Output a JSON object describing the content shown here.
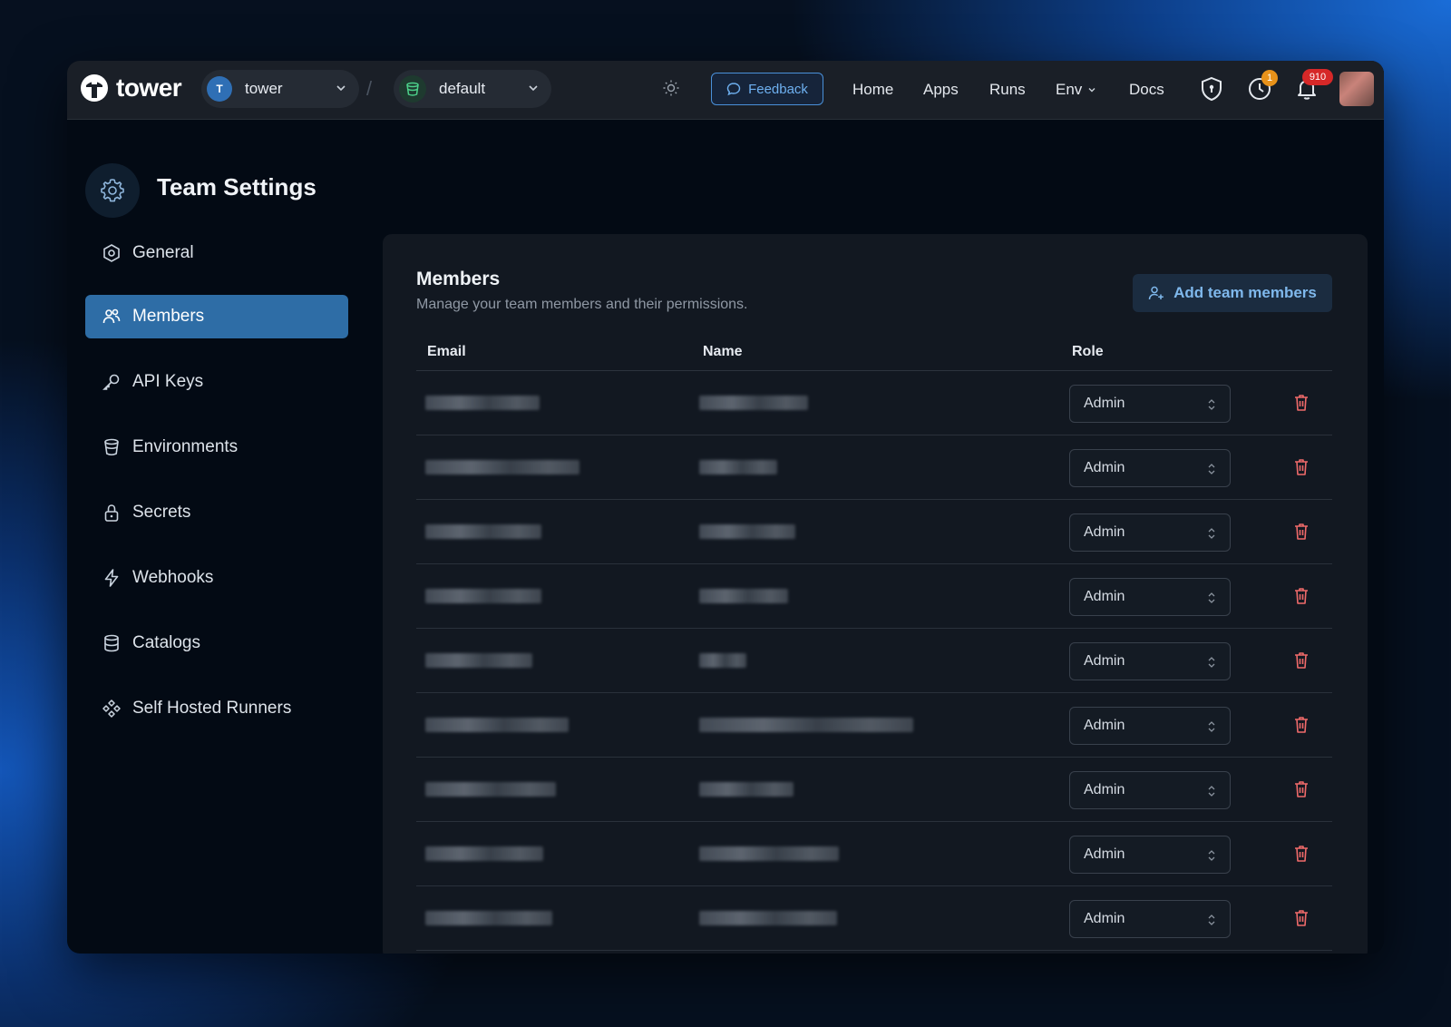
{
  "app": {
    "logo_text": "tower",
    "team_selector": {
      "initial": "T",
      "label": "tower"
    },
    "env_selector": {
      "label": "default"
    },
    "feedback_label": "Feedback",
    "nav": [
      "Home",
      "Apps",
      "Runs",
      "Env",
      "Docs"
    ],
    "runs_badge": "1",
    "notifications_badge": "910",
    "accent": "#2e6da6"
  },
  "sidebar": {
    "title": "Team Settings",
    "items": [
      {
        "label": "General",
        "icon": "hexagon-settings-icon"
      },
      {
        "label": "Members",
        "icon": "users-icon",
        "active": true
      },
      {
        "label": "API Keys",
        "icon": "key-icon"
      },
      {
        "label": "Environments",
        "icon": "bucket-icon"
      },
      {
        "label": "Secrets",
        "icon": "lock-icon"
      },
      {
        "label": "Webhooks",
        "icon": "bolt-icon"
      },
      {
        "label": "Catalogs",
        "icon": "database-icon"
      },
      {
        "label": "Self Hosted Runners",
        "icon": "runners-icon"
      }
    ]
  },
  "members": {
    "title": "Members",
    "subtitle": "Manage your team members and their permissions.",
    "add_button": "Add team members",
    "columns": {
      "email": "Email",
      "name": "Name",
      "role": "Role"
    },
    "rows": [
      {
        "role": "Admin"
      },
      {
        "role": "Admin"
      },
      {
        "role": "Admin"
      },
      {
        "role": "Admin"
      },
      {
        "role": "Admin"
      },
      {
        "role": "Admin"
      },
      {
        "role": "Admin"
      },
      {
        "role": "Admin"
      },
      {
        "role": "Admin"
      }
    ]
  }
}
